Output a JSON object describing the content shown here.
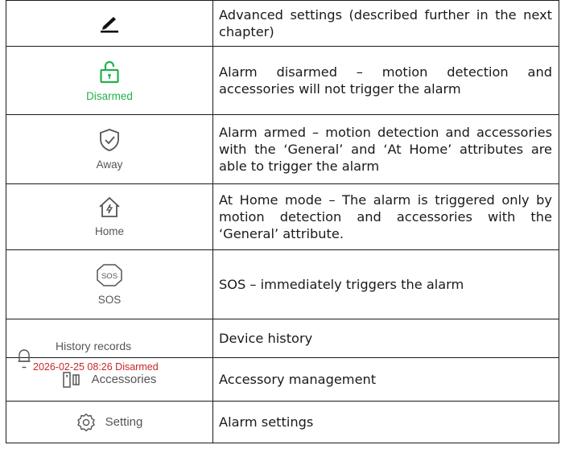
{
  "rows": [
    {
      "icon": "pencil-icon",
      "caption": "",
      "description": "Advanced settings (described further in the next chapter)"
    },
    {
      "icon": "unlocked-padlock-icon",
      "caption": "Disarmed",
      "description": "Alarm disarmed – motion detection and accessories will not trigger the alarm"
    },
    {
      "icon": "shield-check-icon",
      "caption": "Away",
      "description": "Alarm armed – motion detection and accessories with the ‘General’ and ‘At Home’ attributes are able to trigger the alarm"
    },
    {
      "icon": "home-bolt-icon",
      "caption": "Home",
      "description": "At Home mode – The alarm is triggered only by motion detection and accessories with the ‘General’ attribute."
    },
    {
      "icon": "sos-icon",
      "caption": "SOS",
      "badge": "SOS",
      "description": "SOS – immediately triggers the alarm"
    },
    {
      "icon": "bell-icon",
      "caption": "History records",
      "status": "2026-02-25 08:26 Disarmed",
      "description": "Device history"
    },
    {
      "icon": "door-sensor-icon",
      "caption": "Accessories",
      "description": "Accessory management"
    },
    {
      "icon": "gear-icon",
      "caption": "Setting",
      "description": "Alarm settings"
    }
  ],
  "colors": {
    "disarmed_green": "#21b24b",
    "status_red": "#c62828",
    "icon_gray": "#555555"
  }
}
